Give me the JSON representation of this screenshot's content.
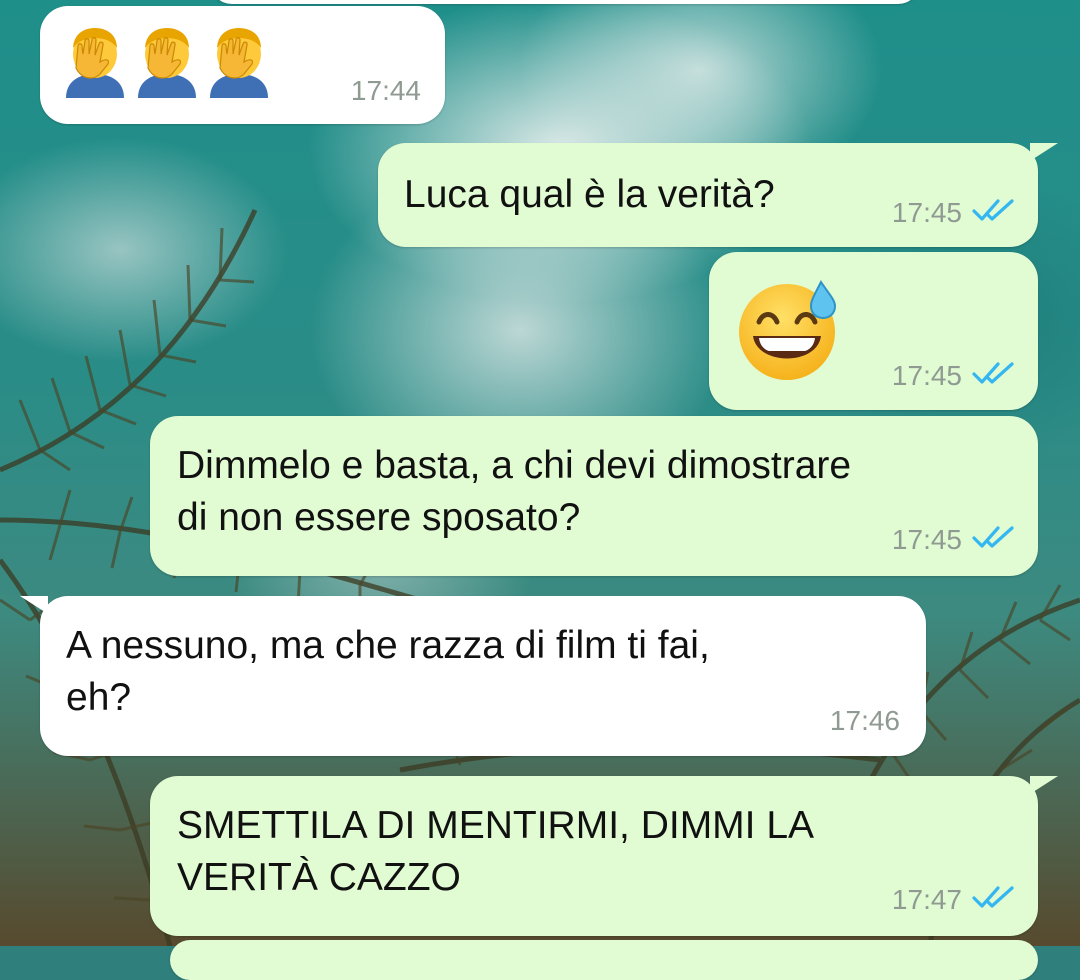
{
  "chat": {
    "messages": [
      {
        "id": "m0",
        "direction": "incoming",
        "emoji": [
          "facepalm",
          "facepalm",
          "facepalm"
        ],
        "time": "17:44"
      },
      {
        "id": "m1",
        "direction": "outgoing",
        "text": "Luca qual è la verità?",
        "time": "17:45",
        "status": "read"
      },
      {
        "id": "m2",
        "direction": "outgoing",
        "emoji": [
          "grinning-sweat"
        ],
        "time": "17:45",
        "status": "read"
      },
      {
        "id": "m3",
        "direction": "outgoing",
        "text": "Dimmelo e basta, a chi devi dimostrare\ndi non essere sposato?",
        "time": "17:45",
        "status": "read"
      },
      {
        "id": "m4",
        "direction": "incoming",
        "text": "A nessuno, ma che razza di film ti fai,\neh?",
        "time": "17:46"
      },
      {
        "id": "m5",
        "direction": "outgoing",
        "text": "SMETTILA DI MENTIRMI, DIMMI LA\nVERITÀ CAZZO",
        "time": "17:47",
        "status": "read"
      }
    ]
  },
  "colors": {
    "incoming_bubble": "#ffffff",
    "outgoing_bubble": "#e1fbd2",
    "timestamp": "#8f9a92",
    "read_ticks": "#34b7f1",
    "text": "#111111"
  },
  "icons": {
    "read_receipt": "double-check-icon",
    "emoji_facepalm": "person-facepalming-emoji",
    "emoji_sweat": "grinning-face-with-sweat-emoji"
  }
}
